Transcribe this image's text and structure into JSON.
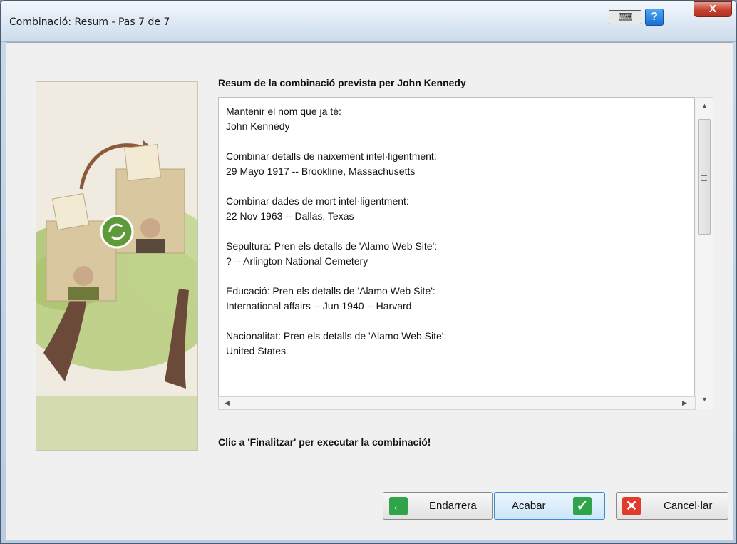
{
  "window": {
    "title": "Combinació: Resum - Pas 7 de 7"
  },
  "header_icons": {
    "keyboard": "keyboard-icon",
    "help_label": "?",
    "close_label": "X"
  },
  "main": {
    "heading": "Resum de la combinació prevista per John Kennedy",
    "summary": [
      {
        "line1": "Mantenir el nom que ja té:",
        "line2": "John Kennedy"
      },
      {
        "line1": "Combinar detalls de naixement intel·ligentment:",
        "line2": "29 Mayo 1917 -- Brookline, Massachusetts"
      },
      {
        "line1": "Combinar dades de mort intel·ligentment:",
        "line2": "22 Nov 1963 -- Dallas, Texas"
      },
      {
        "line1": "Sepultura: Pren els detalls de 'Alamo Web Site':",
        "line2": "? -- Arlington National Cemetery"
      },
      {
        "line1": "Educació: Pren els detalls de 'Alamo Web Site':",
        "line2": "International affairs -- Jun 1940 -- Harvard"
      },
      {
        "line1": "Nacionalitat: Pren els detalls de 'Alamo Web Site':",
        "line2": "United States"
      }
    ],
    "note": "Clic a 'Finalitzar' per executar la combinació!"
  },
  "buttons": {
    "back": "Endarrera",
    "finish": "Acabar",
    "cancel": "Cancel·lar"
  },
  "colors": {
    "accent": "#3c8ad4",
    "green": "#2fa44a",
    "red": "#e03b2b"
  }
}
